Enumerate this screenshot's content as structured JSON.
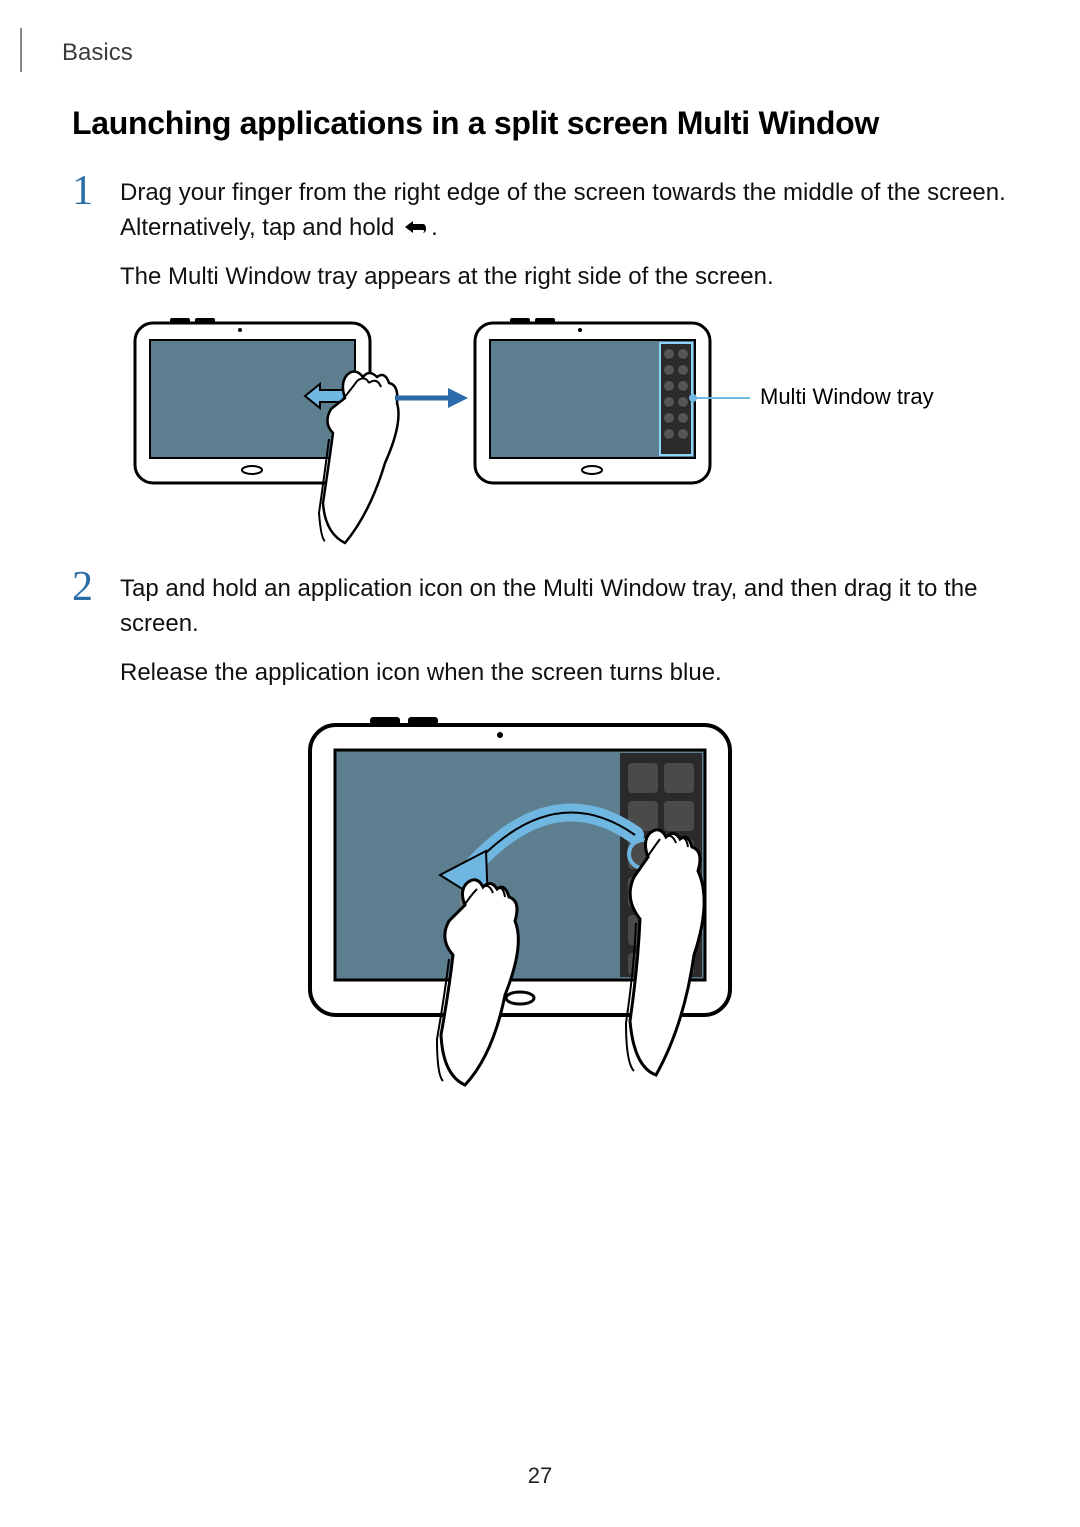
{
  "header": "Basics",
  "page_number": "27",
  "section_title": "Launching applications in a split screen Multi Window",
  "steps": [
    {
      "num": "1",
      "para1_a": "Drag your finger from the right edge of the screen towards the middle of the screen. Alternatively, tap and hold ",
      "para1_b": ".",
      "para2": "The Multi Window tray appears at the right side of the screen.",
      "callout": "Multi Window tray"
    },
    {
      "num": "2",
      "para1": "Tap and hold an application icon on the Multi Window tray, and then drag it to the screen.",
      "para2": "Release the application icon when the screen turns blue."
    }
  ]
}
